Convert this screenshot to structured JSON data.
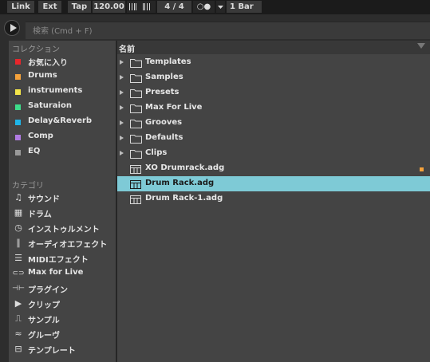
{
  "transport": {
    "link": "Link",
    "ext": "Ext",
    "tap": "Tap",
    "tempo": "120.00",
    "time_signature": "4 / 4",
    "metronome": "○●",
    "quantize": "1 Bar"
  },
  "search": {
    "placeholder": "検索 (Cmd + F)"
  },
  "collections": {
    "heading": "コレクション",
    "items": [
      {
        "label": "お気に入り",
        "color": "#e8262b"
      },
      {
        "label": "Drums",
        "color": "#f5a23b"
      },
      {
        "label": "instruments",
        "color": "#f4e54a"
      },
      {
        "label": "Saturaion",
        "color": "#3ddc8a"
      },
      {
        "label": "Delay&Reverb",
        "color": "#1fb5e8"
      },
      {
        "label": "Comp",
        "color": "#b07be2"
      },
      {
        "label": "EQ",
        "color": "#9a9a9a"
      }
    ]
  },
  "categories": {
    "heading": "カテゴリ",
    "items": [
      {
        "label": "サウンド",
        "icon": "music-note-icon",
        "glyph": "♫"
      },
      {
        "label": "ドラム",
        "icon": "drum-grid-icon",
        "glyph": "▦"
      },
      {
        "label": "インストゥルメント",
        "icon": "clock-icon",
        "glyph": "◷"
      },
      {
        "label": "オーディオエフェクト",
        "icon": "audio-wave-icon",
        "glyph": "∥"
      },
      {
        "label": "MIDIエフェクト",
        "icon": "midi-effect-icon",
        "glyph": "☰"
      },
      {
        "label": "Max for Live",
        "icon": "max-for-live-icon",
        "glyph": "⊂⊃"
      },
      {
        "label": "プラグイン",
        "icon": "plugin-icon",
        "glyph": "⊣⊢"
      },
      {
        "label": "クリップ",
        "icon": "clip-icon",
        "glyph": "▶"
      },
      {
        "label": "サンプル",
        "icon": "sample-waveform-icon",
        "glyph": "⎍"
      },
      {
        "label": "グルーヴ",
        "icon": "groove-icon",
        "glyph": "≈"
      },
      {
        "label": "テンプレート",
        "icon": "template-icon",
        "glyph": "⊟"
      }
    ]
  },
  "browser": {
    "column_header": "名前",
    "items": [
      {
        "label": "Templates",
        "type": "folder"
      },
      {
        "label": "Samples",
        "type": "folder"
      },
      {
        "label": "Presets",
        "type": "folder"
      },
      {
        "label": "Max For Live",
        "type": "folder"
      },
      {
        "label": "Grooves",
        "type": "folder"
      },
      {
        "label": "Defaults",
        "type": "folder"
      },
      {
        "label": "Clips",
        "type": "folder"
      },
      {
        "label": "XO Drumrack.adg",
        "type": "rack",
        "marker_color": "#f5a23b"
      },
      {
        "label": "Drum Rack.adg",
        "type": "rack",
        "selected": true
      },
      {
        "label": "Drum Rack-1.adg",
        "type": "rack"
      }
    ]
  },
  "colors": {
    "selection": "#7ecad6",
    "panel": "#444444",
    "background": "#2d2d2d"
  }
}
